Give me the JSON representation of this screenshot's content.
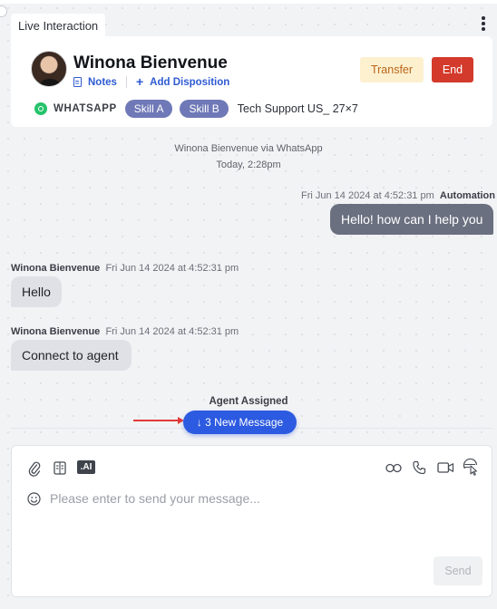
{
  "tab": {
    "label": "Live Interaction"
  },
  "contact": {
    "name": "Winona Bienvenue",
    "notes_label": "Notes",
    "add_disposition_label": "Add Disposition",
    "channel": "WHATSAPP",
    "skills": [
      "Skill A",
      "Skill B"
    ],
    "queue": "Tech Support US_ 27×7"
  },
  "actions": {
    "transfer_label": "Transfer",
    "end_label": "End"
  },
  "conversation": {
    "header_line": "Winona Bienvenue via WhatsApp",
    "header_date": "Today, 2:28pm",
    "messages": [
      {
        "sender": "Automation",
        "timestamp": "Fri Jun 14 2024 at 4:52:31 pm",
        "text": "Hello! how can I help you",
        "direction": "outgoing"
      },
      {
        "sender": "Winona Bienvenue",
        "timestamp": "Fri Jun 14 2024 at 4:52:31 pm",
        "text": "Hello",
        "direction": "incoming"
      },
      {
        "sender": "Winona Bienvenue",
        "timestamp": "Fri Jun 14 2024 at 4:52:31 pm",
        "text": "Connect to agent",
        "direction": "incoming"
      }
    ],
    "system_event": "Agent Assigned",
    "new_messages_label": "↓ 3 New Message"
  },
  "composer": {
    "placeholder": "Please enter to send your message...",
    "send_label": "Send",
    "ai_label": ".AI"
  },
  "colors": {
    "accent": "#2c5ae0",
    "end": "#d33a2b",
    "transfer_bg": "#fdf0cf",
    "skill_chip": "#6f79b7",
    "whatsapp": "#25c36a"
  }
}
